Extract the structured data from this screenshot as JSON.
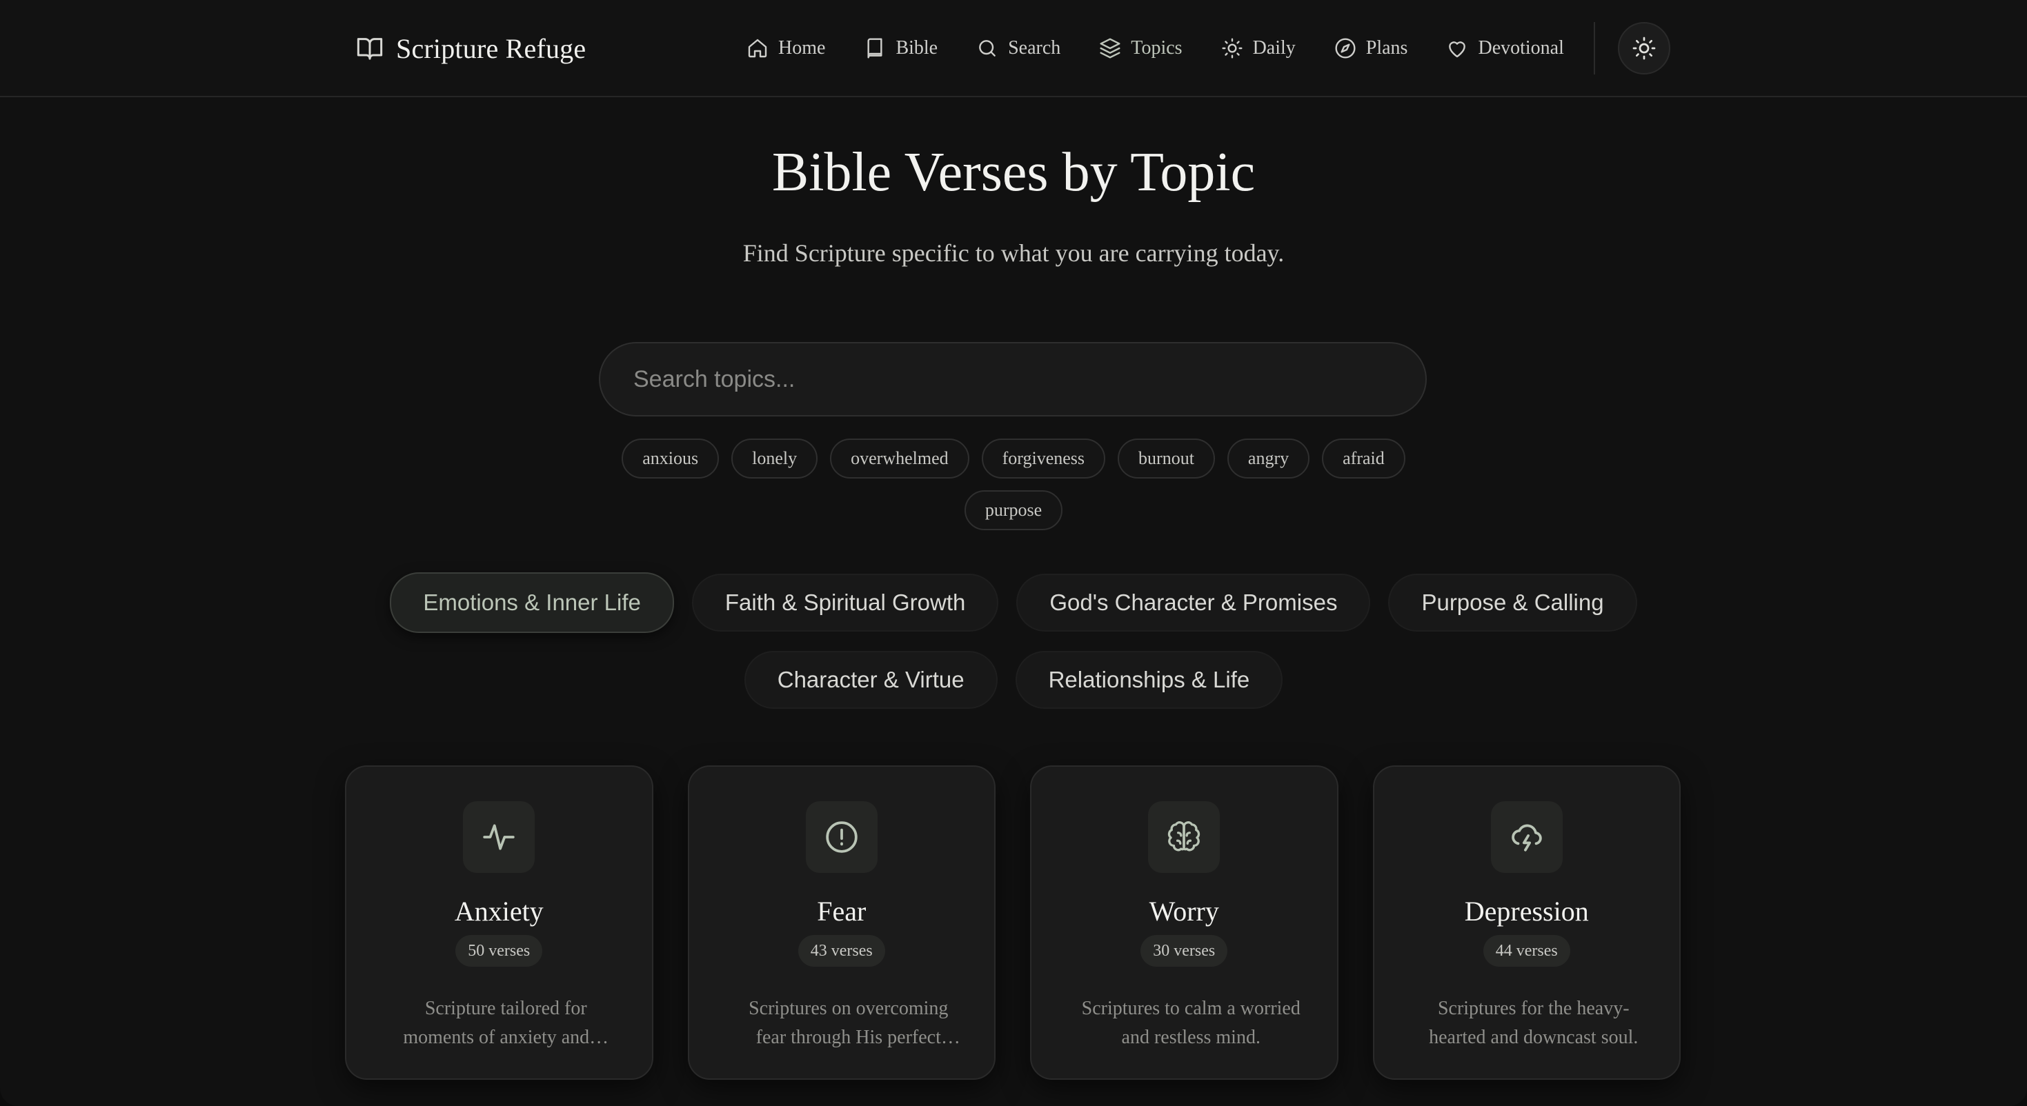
{
  "brand": {
    "name": "Scripture Refuge",
    "icon": "open-book-icon"
  },
  "nav": [
    {
      "label": "Home",
      "icon": "home-icon"
    },
    {
      "label": "Bible",
      "icon": "book-icon"
    },
    {
      "label": "Search",
      "icon": "search-icon"
    },
    {
      "label": "Topics",
      "icon": "layers-icon",
      "active": true
    },
    {
      "label": "Daily",
      "icon": "sun-icon"
    },
    {
      "label": "Plans",
      "icon": "compass-icon"
    },
    {
      "label": "Devotional",
      "icon": "heart-icon"
    }
  ],
  "theme_toggle": {
    "icon": "sun-icon"
  },
  "hero": {
    "title": "Bible Verses by Topic",
    "subtitle": "Find Scripture specific to what you are carrying today."
  },
  "search": {
    "placeholder": "Search topics...",
    "value": ""
  },
  "quick_tags": [
    "anxious",
    "lonely",
    "overwhelmed",
    "forgiveness",
    "burnout",
    "angry",
    "afraid",
    "purpose"
  ],
  "categories": [
    {
      "label": "Emotions & Inner Life",
      "active": true
    },
    {
      "label": "Faith & Spiritual Growth"
    },
    {
      "label": "God's Character & Promises"
    },
    {
      "label": "Purpose & Calling"
    },
    {
      "label": "Character & Virtue"
    },
    {
      "label": "Relationships & Life"
    }
  ],
  "topics": [
    {
      "title": "Anxiety",
      "count": "50 verses",
      "desc": "Scripture tailored for moments of anxiety and…",
      "icon": "pulse-icon"
    },
    {
      "title": "Fear",
      "count": "43 verses",
      "desc": "Scriptures on overcoming fear through His perfect love.",
      "icon": "alert-circle-icon"
    },
    {
      "title": "Worry",
      "count": "30 verses",
      "desc": "Scriptures to calm a worried and restless mind.",
      "icon": "brain-icon"
    },
    {
      "title": "Depression",
      "count": "44 verses",
      "desc": "Scriptures for the heavy-hearted and downcast soul.",
      "icon": "storm-cloud-icon"
    }
  ],
  "colors": {
    "background": "#111111",
    "accent": "#b9c4b5",
    "card": "#1b1b1b"
  }
}
